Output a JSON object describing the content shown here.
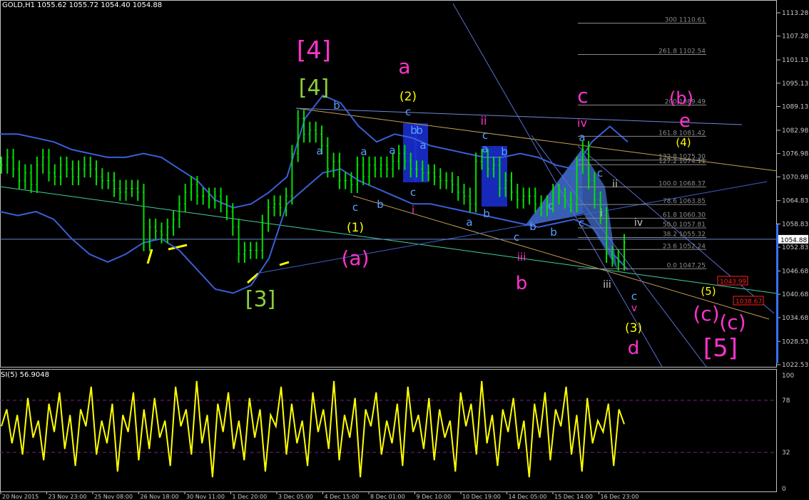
{
  "header": {
    "symbol": "GOLD,H1",
    "ohlc": "1055.62 1055.72 1054.40 1054.88"
  },
  "indicator": {
    "label": "SI(5) 56.9048"
  },
  "colors": {
    "background": "#000000",
    "grid": "#c0c0c0",
    "candles": "#00e000",
    "bollinger": "#3a5fd8",
    "rsi": "#ffff00",
    "magenta": "#ff33cc",
    "olive": "#8ccf3a",
    "yellow": "#ffff00",
    "lightblue": "#5aa0ff",
    "white": "#c8c8c8",
    "fib": "#8a8a8a",
    "price_line": "#6e87c8",
    "alert": "#ff2020"
  },
  "chart_data": [
    {
      "type": "line",
      "title": "GOLD,H1 1055.62 1055.72 1054.40 1054.88",
      "ylim": [
        1022.53,
        1113.28
      ],
      "y_ticks": [
        "1113.28",
        "1107.28",
        "1101.13",
        "1095.13",
        "1089.13",
        "1082.98",
        "1076.98",
        "1070.98",
        "1064.83",
        "1058.83",
        "1052.83",
        "1046.68",
        "1040.68",
        "1034.68",
        "1028.53",
        "1022.53"
      ],
      "current_price": "1054.88",
      "x_ticks": [
        "20 Nov 2015",
        "23 Nov 23:00",
        "25 Nov 08:00",
        "26 Nov 18:00",
        "30 Nov 11:00",
        "1 Dec 20:00",
        "3 Dec 05:00",
        "4 Dec 15:00",
        "8 Dec 01:00",
        "9 Dec 10:00",
        "10 Dec 19:00",
        "14 Dec 05:00",
        "15 Dec 14:00",
        "16 Dec 23:00"
      ],
      "series": [
        {
          "values": [
            1074,
            1076,
            1073,
            1070,
            1072,
            1069,
            1074,
            1076,
            1072,
            1071,
            1074,
            1073,
            1071,
            1073,
            1074,
            1073,
            1071,
            1070,
            1070,
            1068,
            1067,
            1068,
            1068,
            1067,
            1054,
            1058,
            1057,
            1056,
            1058,
            1060,
            1064,
            1067,
            1069,
            1066,
            1066,
            1065,
            1066,
            1064,
            1062,
            1058,
            1051,
            1052,
            1052,
            1052,
            1059,
            1063,
            1064,
            1063,
            1066,
            1077,
            1086,
            1082,
            1083,
            1082,
            1079,
            1073,
            1075,
            1070,
            1070,
            1069,
            1074,
            1071,
            1074,
            1073,
            1074,
            1073,
            1075,
            1077,
            1075,
            1073,
            1073,
            1072,
            1072,
            1071,
            1070,
            1070,
            1069,
            1067,
            1066,
            1064,
            1075,
            1076,
            1073,
            1074,
            1068,
            1070,
            1067,
            1065,
            1066,
            1066,
            1064,
            1063,
            1064,
            1067,
            1066,
            1065,
            1064,
            1074,
            1078,
            1070,
            1065,
            1061,
            1051,
            1050,
            1049,
            1054
          ]
        },
        {
          "values": [
            1082,
            1082,
            1081,
            1080,
            1078,
            1077,
            1076,
            1076,
            1077,
            1076,
            1073,
            1070,
            1065,
            1063,
            1064,
            1067,
            1071,
            1086,
            1092,
            1090,
            1084,
            1080,
            1082,
            1081,
            1079,
            1078,
            1077,
            1076,
            1076,
            1077,
            1076,
            1074,
            1073,
            1080,
            1084,
            1080
          ]
        },
        {
          "values": [
            1062,
            1061,
            1062,
            1060,
            1055,
            1051,
            1049,
            1051,
            1054,
            1055,
            1052,
            1047,
            1042,
            1041,
            1043,
            1050,
            1064,
            1068,
            1072,
            1073,
            1070,
            1068,
            1066,
            1064,
            1064,
            1063,
            1062,
            1061,
            1060,
            1059,
            1058,
            1059,
            1060,
            1058,
            1052,
            1047
          ]
        }
      ],
      "fib_levels": [
        {
          "label": "300 1110.61"
        },
        {
          "label": "261.8 1102.54"
        },
        {
          "label": "200 1089.49"
        },
        {
          "label": "161.8 1081.42"
        },
        {
          "label": "132.8 1075.30"
        },
        {
          "label": "127.2 1074.11"
        },
        {
          "label": "100.0 1068.37"
        },
        {
          "label": "78.6 1063.85"
        },
        {
          "label": "61.8 1060.30"
        },
        {
          "label": "50.0 1057.81"
        },
        {
          "label": "38.2 1055.32"
        },
        {
          "label": "23.6 1052.24"
        },
        {
          "label": "0.0 1047.25"
        }
      ],
      "price_tags": [
        "1043.99",
        "1038.67"
      ],
      "wave_labels": [
        {
          "text": "[4]",
          "color": "magenta",
          "size": 34
        },
        {
          "text": "[4]",
          "color": "olive",
          "size": 30
        },
        {
          "text": "[3]",
          "color": "olive",
          "size": 30
        },
        {
          "text": "a",
          "color": "magenta",
          "size": 28
        },
        {
          "text": "(2)",
          "color": "yellow",
          "size": 17
        },
        {
          "text": "(1)",
          "color": "yellow",
          "size": 17
        },
        {
          "text": "(a)",
          "color": "magenta",
          "size": 28
        },
        {
          "text": "b",
          "color": "magenta",
          "size": 26
        },
        {
          "text": "c",
          "color": "magenta",
          "size": 28
        },
        {
          "text": "(b)",
          "color": "magenta",
          "size": 24
        },
        {
          "text": "e",
          "color": "magenta",
          "size": 26
        },
        {
          "text": "(4)",
          "color": "yellow",
          "size": 15
        },
        {
          "text": "(5)",
          "color": "yellow",
          "size": 15
        },
        {
          "text": "(3)",
          "color": "yellow",
          "size": 17
        },
        {
          "text": "d",
          "color": "magenta",
          "size": 26
        },
        {
          "text": "(c)",
          "color": "magenta",
          "size": 28
        },
        {
          "text": "(c)",
          "color": "magenta",
          "size": 28
        },
        {
          "text": "[5]",
          "color": "magenta",
          "size": 34
        },
        {
          "text": "ii",
          "color": "magenta",
          "size": 16
        },
        {
          "text": "iv",
          "color": "magenta",
          "size": 16
        },
        {
          "text": "i",
          "color": "magenta",
          "size": 15
        },
        {
          "text": "iii",
          "color": "magenta",
          "size": 15
        },
        {
          "text": "v",
          "color": "magenta",
          "size": 14
        },
        {
          "text": "ii",
          "color": "white",
          "size": 14
        },
        {
          "text": "i",
          "color": "white",
          "size": 14
        },
        {
          "text": "iv",
          "color": "white",
          "size": 14
        },
        {
          "text": "iii",
          "color": "white",
          "size": 14
        },
        {
          "text": "b",
          "color": "lightblue",
          "size": 15
        },
        {
          "text": "a",
          "color": "lightblue",
          "size": 15
        },
        {
          "text": "c",
          "color": "lightblue",
          "size": 15
        },
        {
          "text": "a",
          "color": "lightblue",
          "size": 15
        },
        {
          "text": "b",
          "color": "lightblue",
          "size": 15
        },
        {
          "text": "a",
          "color": "lightblue",
          "size": 15
        },
        {
          "text": "c",
          "color": "lightblue",
          "size": 15
        },
        {
          "text": "b",
          "color": "lightblue",
          "size": 15
        },
        {
          "text": "a",
          "color": "lightblue",
          "size": 15
        },
        {
          "text": "c",
          "color": "lightblue",
          "size": 15
        },
        {
          "text": "c",
          "color": "lightblue",
          "size": 15
        },
        {
          "text": "b",
          "color": "lightblue",
          "size": 15
        },
        {
          "text": "b",
          "color": "lightblue",
          "size": 15
        },
        {
          "text": "a",
          "color": "lightblue",
          "size": 15
        },
        {
          "text": "c",
          "color": "lightblue",
          "size": 15
        },
        {
          "text": "b",
          "color": "lightblue",
          "size": 15
        },
        {
          "text": "a",
          "color": "lightblue",
          "size": 15
        },
        {
          "text": "b",
          "color": "lightblue",
          "size": 15
        },
        {
          "text": "c",
          "color": "lightblue",
          "size": 15
        },
        {
          "text": "b",
          "color": "lightblue",
          "size": 15
        },
        {
          "text": "c",
          "color": "lightblue",
          "size": 15
        },
        {
          "text": "a",
          "color": "lightblue",
          "size": 15
        },
        {
          "text": "c",
          "color": "lightblue",
          "size": 15
        },
        {
          "text": "c",
          "color": "lightblue",
          "size": 15
        }
      ]
    },
    {
      "type": "line",
      "title": "SI(5) 56.9048",
      "ylim": [
        0,
        100
      ],
      "y_ticks": [
        "100",
        "78",
        "32",
        "0"
      ],
      "levels": [
        78,
        32
      ],
      "series": [
        {
          "values": [
            55,
            70,
            40,
            65,
            30,
            80,
            45,
            60,
            25,
            75,
            50,
            85,
            35,
            65,
            20,
            70,
            55,
            90,
            30,
            60,
            40,
            75,
            15,
            65,
            50,
            85,
            25,
            70,
            35,
            80,
            45,
            60,
            20,
            90,
            55,
            70,
            30,
            95,
            40,
            65,
            10,
            75,
            50,
            85,
            35,
            60,
            25,
            80,
            45,
            70,
            15,
            65,
            55,
            90,
            30,
            75,
            40,
            60,
            20,
            85,
            50,
            70,
            35,
            95,
            25,
            65,
            45,
            80,
            10,
            70,
            55,
            85,
            30,
            60,
            40,
            75,
            20,
            90,
            50,
            65,
            35,
            80,
            25,
            70,
            45,
            60,
            15,
            85,
            55,
            75,
            30,
            95,
            40,
            65,
            20,
            70,
            50,
            80,
            35,
            60,
            10,
            75,
            45,
            85,
            25,
            70,
            55,
            90,
            30,
            65,
            15,
            80,
            40,
            60,
            50,
            75,
            20,
            70,
            57
          ]
        }
      ]
    }
  ]
}
